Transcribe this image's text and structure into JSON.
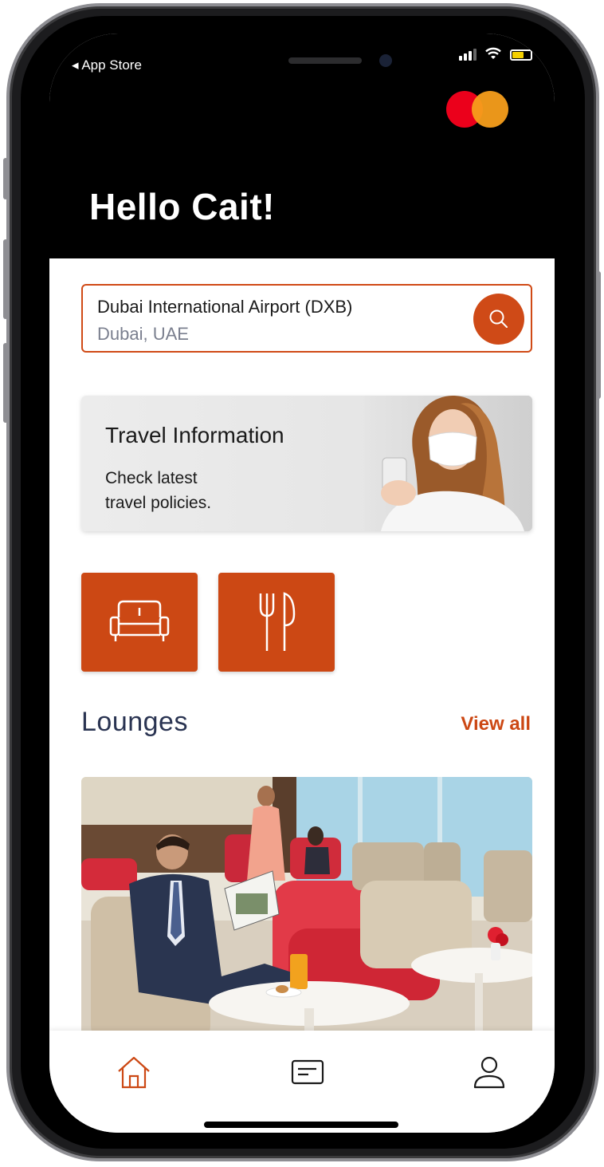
{
  "status_bar": {
    "back_label": "◂ App Store"
  },
  "header": {
    "greeting": "Hello Cait!",
    "brand_logo": "mastercard-logo"
  },
  "search": {
    "airport": "Dubai International Airport (DXB)",
    "location": "Dubai, UAE",
    "icon": "search-icon"
  },
  "travel_card": {
    "title": "Travel Information",
    "description_line1": "Check latest",
    "description_line2": "travel policies."
  },
  "categories": [
    {
      "icon": "lounge-sofa-icon"
    },
    {
      "icon": "dining-fork-knife-icon"
    }
  ],
  "lounges": {
    "title": "Lounges",
    "view_all": "View all"
  },
  "tab_bar": {
    "items": [
      {
        "icon": "home-icon",
        "active": true
      },
      {
        "icon": "card-icon",
        "active": false
      },
      {
        "icon": "profile-icon",
        "active": false
      }
    ]
  },
  "colors": {
    "accent": "#cc4814",
    "header_bg": "#000000",
    "heading_text": "#2a3452",
    "muted_text": "#7a7f8e"
  }
}
